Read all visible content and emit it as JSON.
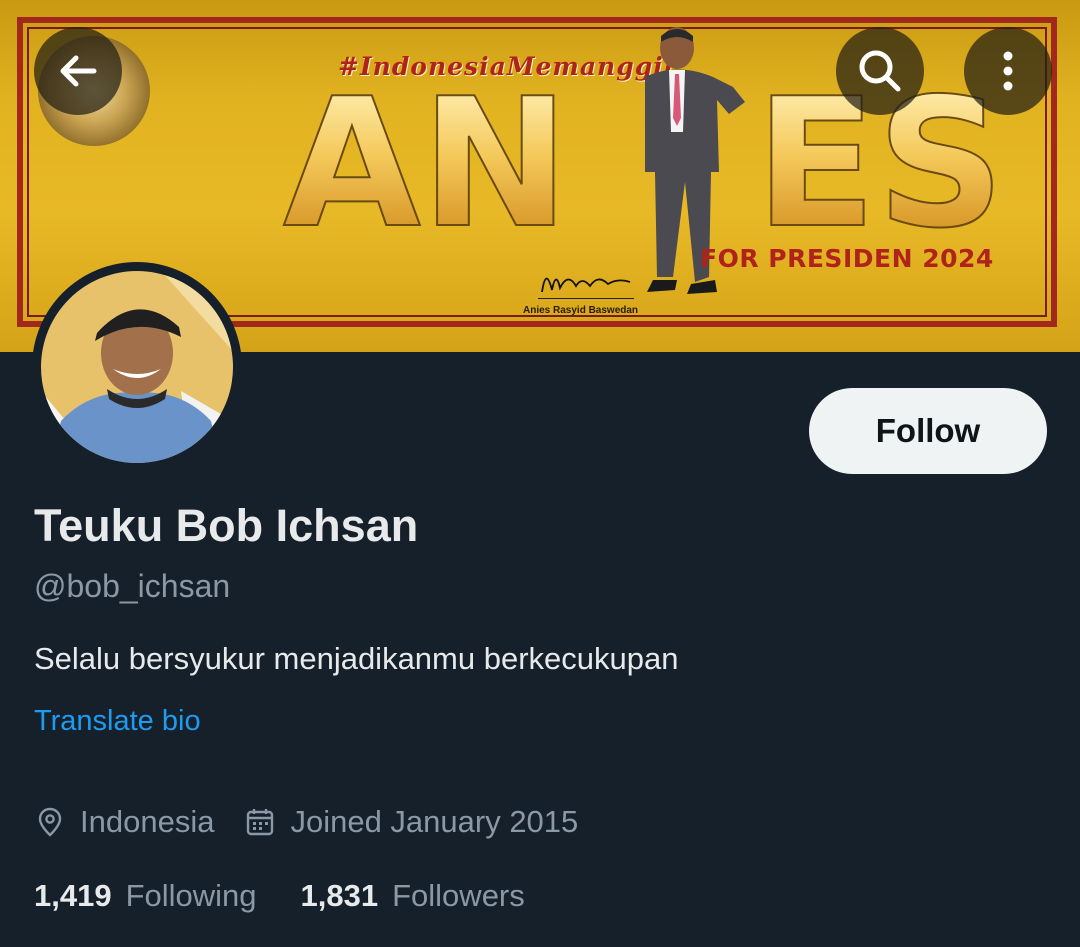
{
  "banner": {
    "hashtag": "#IndonesiaMemanggil",
    "name_left": "AN",
    "name_right": "ES",
    "tagline": "FOR PRESIDEN 2024",
    "signature_caption": "Anies Rasyid Baswedan"
  },
  "header": {
    "back_icon": "arrow-left-icon",
    "search_icon": "search-icon",
    "more_icon": "more-vertical-icon"
  },
  "profile": {
    "follow_label": "Follow",
    "display_name": "Teuku Bob Ichsan",
    "handle": "@bob_ichsan",
    "bio": "Selalu bersyukur menjadikanmu berkecukupan",
    "translate_label": "Translate bio",
    "location": "Indonesia",
    "joined": "Joined January 2015",
    "following_count": "1,419",
    "following_label": "Following",
    "followers_count": "1,831",
    "followers_label": "Followers"
  },
  "colors": {
    "background": "#15202b",
    "accent": "#1d9bf0",
    "text_primary": "#e7e9ea",
    "text_secondary": "#8b98a5"
  }
}
